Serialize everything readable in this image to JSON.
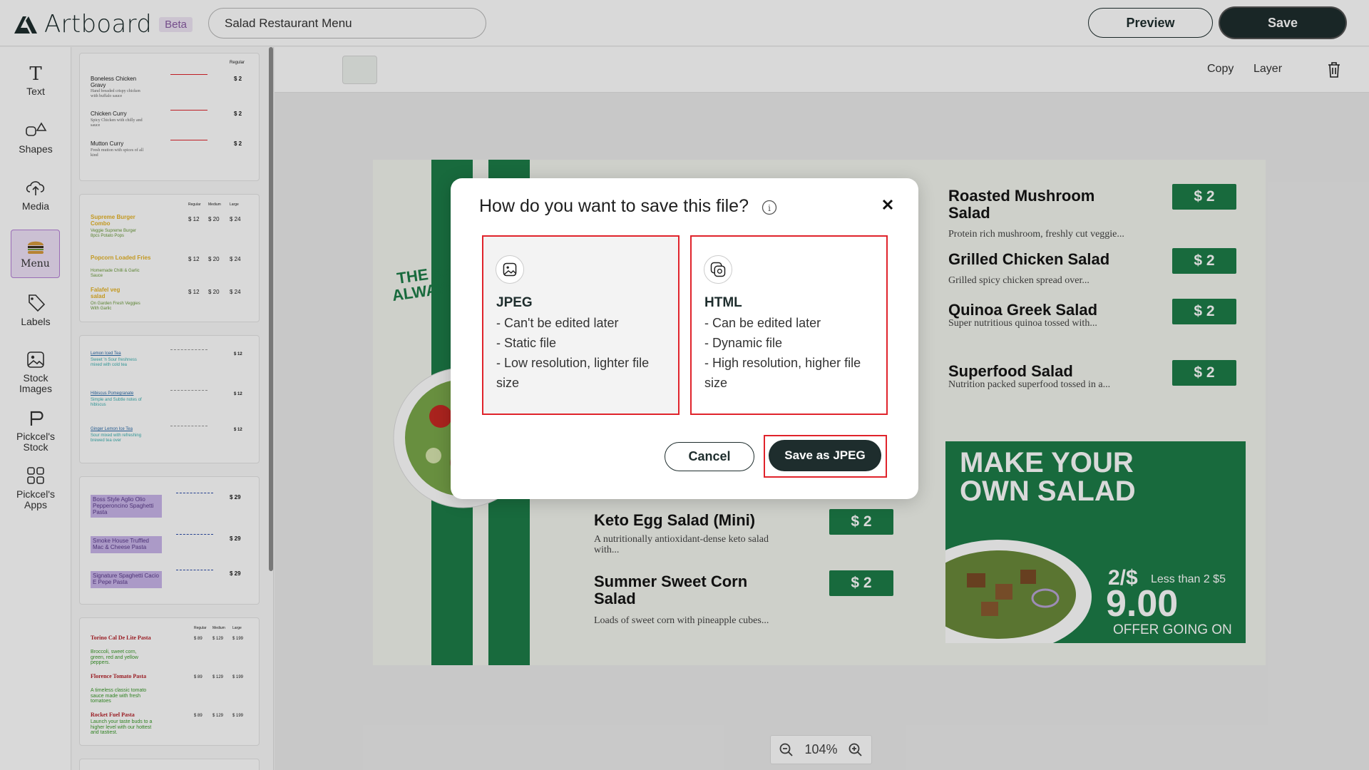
{
  "topbar": {
    "app_name": "Artboard",
    "beta_label": "Beta",
    "document_title": "Salad Restaurant Menu",
    "preview_label": "Preview",
    "save_label": "Save"
  },
  "rail": {
    "items": [
      {
        "label": "Text",
        "icon": "text-icon"
      },
      {
        "label": "Shapes",
        "icon": "shapes-icon"
      },
      {
        "label": "Media",
        "icon": "upload-cloud-icon"
      },
      {
        "label": "Menu",
        "icon": "burger-icon",
        "active": true
      },
      {
        "label": "Labels",
        "icon": "tag-icon"
      },
      {
        "label": "Stock Images",
        "icon": "image-icon"
      },
      {
        "label": "Pickcel's Stock",
        "icon": "pickcel-stock-icon"
      },
      {
        "label": "Pickcel's Apps",
        "icon": "apps-grid-icon"
      }
    ]
  },
  "thumbnails": {
    "t1": {
      "header": "Regular",
      "rows": [
        {
          "name": "Boneless Chicken Gravy",
          "desc": "Hand breaded crispy chicken with buffalo sauce",
          "price": "$ 2"
        },
        {
          "name": "Chicken Curry",
          "desc": "Spicy Chicken with chilly and sauce",
          "price": "$ 2"
        },
        {
          "name": "Mutton Curry",
          "desc": "Fresh mutton with spices of all kind",
          "price": "$ 2"
        }
      ]
    },
    "t2": {
      "headers": [
        "Regular",
        "Medium",
        "Large"
      ],
      "rows": [
        {
          "name": "Supreme Burger Combo",
          "desc": "Veggie Supreme Burger 8pcs Potato Pops",
          "prices": [
            "$ 12",
            "$ 20",
            "$ 24"
          ]
        },
        {
          "name": "Popcorn Loaded Fries",
          "desc": "Homemade Chilli & Garlic Sauce",
          "prices": [
            "$ 12",
            "$ 20",
            "$ 24"
          ]
        },
        {
          "name": "Falafel veg salad",
          "desc": "On Garden Fresh Veggies With Garlic",
          "prices": [
            "$ 12",
            "$ 20",
            "$ 24"
          ]
        }
      ]
    },
    "t3": {
      "rows": [
        {
          "name": "Lemon Iced Tea",
          "desc": "Sweet 'n Sour freshness mixed with cold tea",
          "price": "$ 12"
        },
        {
          "name": "Hibiscus Pomegranate",
          "desc": "Simple and Subtle notes of hibiscus",
          "price": "$ 12"
        },
        {
          "name": "Ginger Lemon Ice Tea",
          "desc": "Sour mixed with refreshing brewed tea over",
          "price": "$ 12"
        }
      ]
    },
    "t4": {
      "rows": [
        {
          "name": "Boss Style Aglio Olio Pepperoncino Spaghetti Pasta",
          "price": "$ 29"
        },
        {
          "name": "Smoke House Truffled Mac & Cheese Pasta",
          "price": "$ 29"
        },
        {
          "name": "Signature Spaghetti Cacio E Pepe Pasta",
          "price": "$ 29"
        }
      ]
    },
    "t5": {
      "headers": [
        "Regular",
        "Medium",
        "Large"
      ],
      "rows": [
        {
          "name": "Torino Cal De Lite Pasta",
          "desc": "Broccoli, sweet corn, green, red and yellow peppers.",
          "prices": [
            "$ 89",
            "$ 129",
            "$ 199"
          ]
        },
        {
          "name": "Florence Tomato Pasta",
          "desc": "A timeless classic tomato sauce made with fresh tomatoes",
          "prices": [
            "$ 89",
            "$ 129",
            "$ 199"
          ]
        },
        {
          "name": "Rocket Fuel Pasta",
          "desc": "Launch your taste buds to a higher level with our hottest and tastiest.",
          "prices": [
            "$ 89",
            "$ 129",
            "$ 199"
          ]
        }
      ]
    }
  },
  "subbar": {
    "copy_label": "Copy",
    "layer_label": "Layer"
  },
  "design": {
    "banner": "THE SA... ALWAYS",
    "banner_line1": "THE SA",
    "banner_line2": "ALWAYS",
    "right_items": [
      {
        "title": "Roasted Mushroom Salad",
        "desc": "Protein rich mushroom, freshly cut veggie...",
        "price": "$ 2"
      },
      {
        "title": "Grilled Chicken Salad",
        "desc": "Grilled spicy chicken spread over...",
        "price": "$ 2"
      },
      {
        "title": "Quinoa Greek Salad",
        "desc": "Super nutritious quinoa tossed with...",
        "price": "$ 2"
      },
      {
        "title": "Superfood Salad",
        "desc": "Nutrition packed superfood tossed in a...",
        "price": "$ 2"
      }
    ],
    "left_items": [
      {
        "title": "Keto Egg Salad (Mini)",
        "desc": "A nutritionally antioxidant-dense keto salad with...",
        "price": "$ 2"
      },
      {
        "title": "Summer Sweet Corn Salad",
        "desc": "Loads of sweet corn with pineapple cubes...",
        "price": "$ 2"
      }
    ],
    "promo": {
      "headline_1": "MAKE YOUR",
      "headline_2": "OWN SALAD",
      "deal": "2/$",
      "deal_note": "Less than 2 $5",
      "price": "9.00",
      "offer": "OFFER GOING ON"
    },
    "brand_green": "#1d7d48"
  },
  "zoom": {
    "level": "104%"
  },
  "dialog": {
    "title": "How do you want to save this file?",
    "options": [
      {
        "name": "JPEG",
        "lines": [
          "- Can't be edited later",
          "- Static file",
          "- Low resolution, lighter file size"
        ],
        "selected": true,
        "icon": "image-icon"
      },
      {
        "name": "HTML",
        "lines": [
          "- Can be edited later",
          "- Dynamic file",
          "- High resolution, higher file size"
        ],
        "selected": false,
        "icon": "html-file-icon"
      }
    ],
    "cancel_label": "Cancel",
    "confirm_label": "Save as JPEG",
    "highlight_color": "#e0232b",
    "dark_color": "#1e2d2d"
  }
}
